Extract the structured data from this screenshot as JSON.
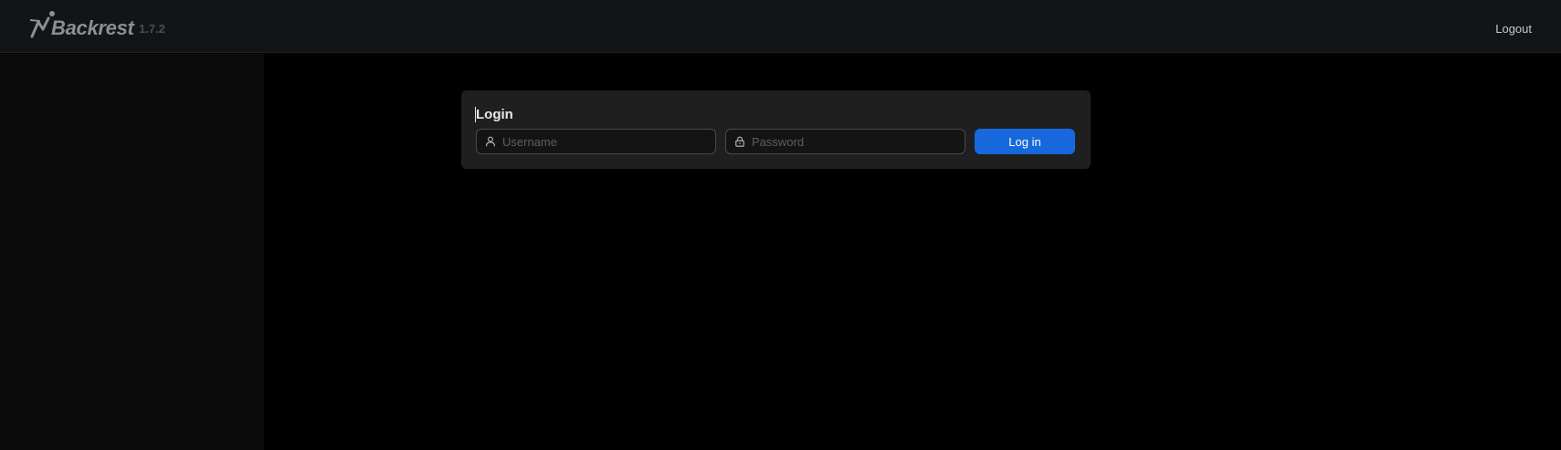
{
  "header": {
    "app_name": "Backrest",
    "version": "1.7.2",
    "logout_label": "Logout"
  },
  "login": {
    "title": "Login",
    "username": {
      "placeholder": "Username",
      "value": "",
      "icon": "user-icon"
    },
    "password": {
      "placeholder": "Password",
      "value": "",
      "icon": "lock-icon"
    },
    "submit_label": "Log in"
  },
  "colors": {
    "header_bg": "#111518",
    "sidebar_bg": "#0b0b0b",
    "content_bg": "#000000",
    "card_bg": "#1f1f1f",
    "primary": "#1668dc"
  }
}
